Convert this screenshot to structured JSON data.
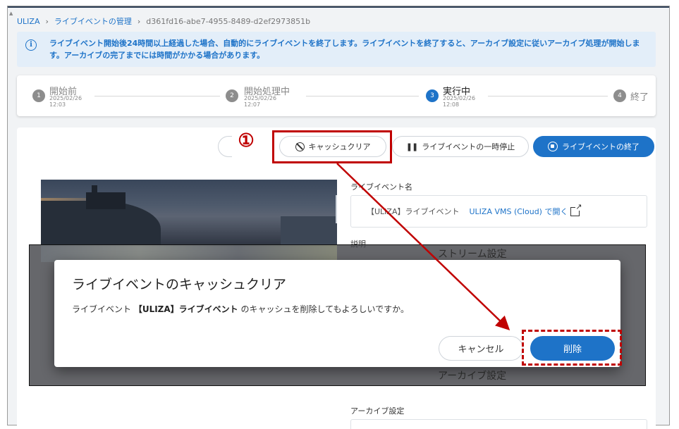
{
  "breadcrumb": {
    "root": "ULIZA",
    "sep": "›",
    "section": "ライブイベントの管理",
    "current": "d361fd16-abe7-4955-8489-d2ef2973851b"
  },
  "info": {
    "icon": "info-icon",
    "icon_glyph": "i",
    "text": "ライブイベント開始後24時間以上経過した場合、自動的にライブイベントを終了します。ライブイベントを終了すると、アーカイブ設定に従いアーカイブ処理が開始します。アーカイブの完了までには時間がかかる場合があります。"
  },
  "steps": [
    {
      "num": "1",
      "label": "開始前",
      "date": "2025/02/26",
      "time": "12:03"
    },
    {
      "num": "2",
      "label": "開始処理中",
      "date": "2025/02/26",
      "time": "12:07"
    },
    {
      "num": "3",
      "label": "実行中",
      "date": "2025/02/26",
      "time": "12:08"
    },
    {
      "num": "4",
      "label": "終了"
    }
  ],
  "actions": {
    "cache_clear": "キャッシュクリア",
    "pause": "ライブイベントの一時停止",
    "end": "ライブイベントの終了",
    "pause_glyph": "❚❚"
  },
  "annotation": {
    "marker": "①",
    "color": "#c00000"
  },
  "fields": {
    "name_label": "ライブイベント名",
    "name_value": "【ULIZA】ライブイベント",
    "open_link": "ULIZA VMS (Cloud) で開く",
    "description_label": "説明"
  },
  "background_sections": {
    "stream_settings": "ストリーム設定",
    "archive_settings": "アーカイブ設定",
    "archive_settings_label": "アーカイブ設定"
  },
  "dialog": {
    "title": "ライブイベントのキャッシュクリア",
    "body_prefix": "ライブイベント ",
    "body_name": "【ULIZA】ライブイベント",
    "body_suffix": " のキャッシュを削除してもよろしいですか。",
    "cancel": "キャンセル",
    "delete": "削除"
  },
  "colors": {
    "accent": "#1e73c8",
    "highlight": "#c00000",
    "info_bg": "#e3eef9"
  }
}
